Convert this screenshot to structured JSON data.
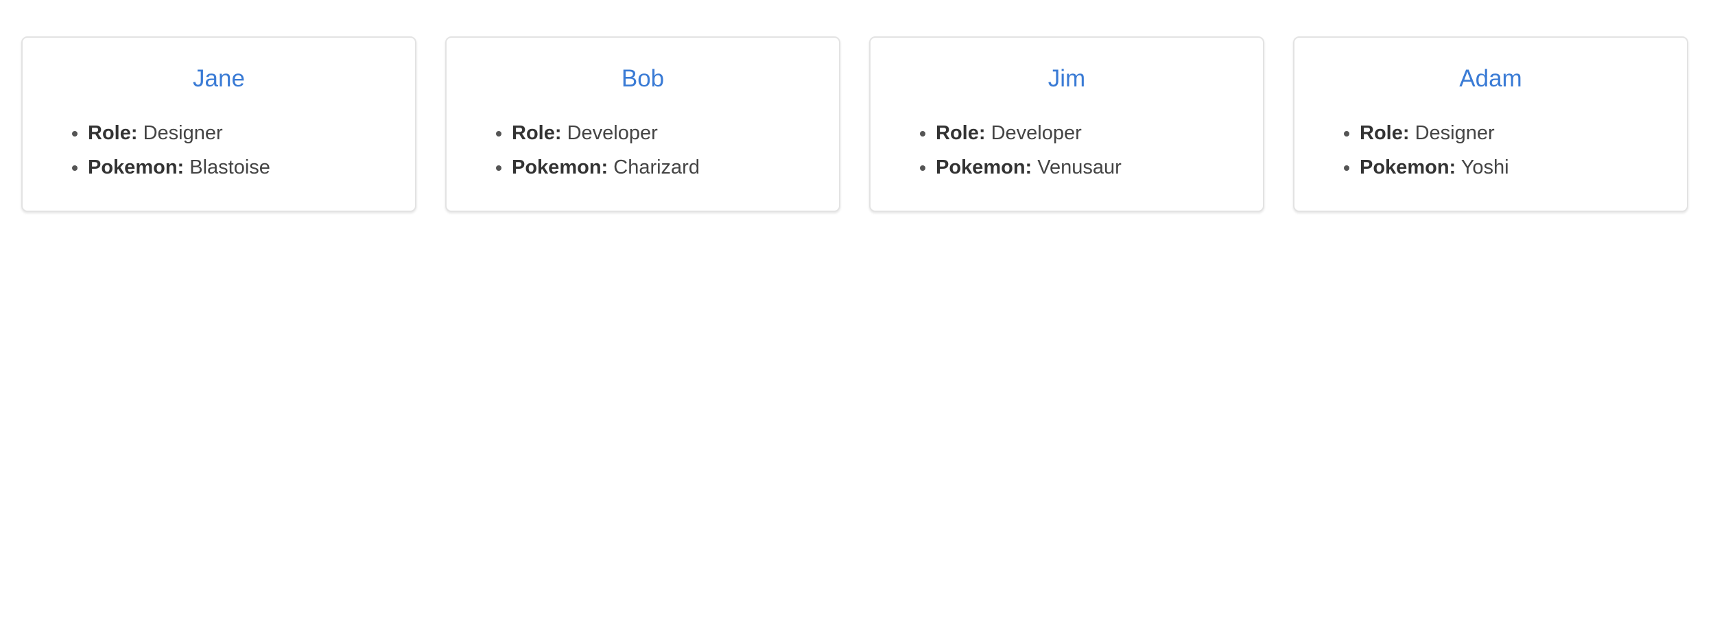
{
  "labels": {
    "role": "Role:",
    "pokemon": "Pokemon:"
  },
  "colors": {
    "name_link": "#3a7bd5",
    "text": "#444444",
    "card_border": "#e3e3e3"
  },
  "people": [
    {
      "name": "Jane",
      "role": "Designer",
      "pokemon": "Blastoise"
    },
    {
      "name": "Bob",
      "role": "Developer",
      "pokemon": "Charizard"
    },
    {
      "name": "Jim",
      "role": "Developer",
      "pokemon": "Venusaur"
    },
    {
      "name": "Adam",
      "role": "Designer",
      "pokemon": "Yoshi"
    }
  ]
}
